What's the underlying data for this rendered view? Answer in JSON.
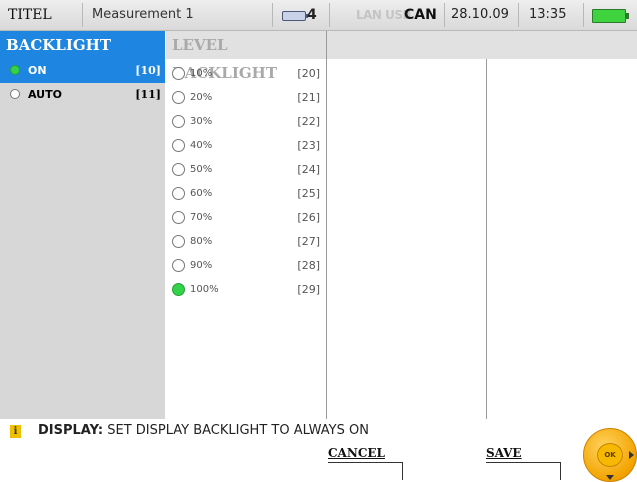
{
  "statusbar": {
    "title": "TITEL",
    "measurement": "Measurement 1",
    "battery_count": "4",
    "can_inactive": "LAN USB",
    "can_label": "CAN",
    "date": "28.10.09",
    "time": "13:35",
    "power_icon": "battery-full-icon",
    "power_color": "#3fd33f"
  },
  "column1": {
    "header": "BACKLIGHT",
    "options": [
      {
        "label": "ON",
        "code": "[10]",
        "selected": true
      },
      {
        "label": "AUTO",
        "code": "[11]",
        "selected": false
      }
    ]
  },
  "column2": {
    "header": "LEVEL BACKLIGHT",
    "levels": [
      {
        "label": "10%",
        "code": "[20]",
        "selected": false
      },
      {
        "label": "20%",
        "code": "[21]",
        "selected": false
      },
      {
        "label": "30%",
        "code": "[22]",
        "selected": false
      },
      {
        "label": "40%",
        "code": "[23]",
        "selected": false
      },
      {
        "label": "50%",
        "code": "[24]",
        "selected": false
      },
      {
        "label": "60%",
        "code": "[25]",
        "selected": false
      },
      {
        "label": "70%",
        "code": "[26]",
        "selected": false
      },
      {
        "label": "80%",
        "code": "[27]",
        "selected": false
      },
      {
        "label": "90%",
        "code": "[28]",
        "selected": false
      },
      {
        "label": "100%",
        "code": "[29]",
        "selected": true
      }
    ]
  },
  "info": {
    "icon": "info-icon",
    "icon_glyph": "i",
    "prefix": "DISPLAY:",
    "text": " SET DISPLAY BACKLIGHT TO ALWAYS ON"
  },
  "softkeys": {
    "cancel": "CANCEL",
    "save": "SAVE"
  },
  "joystick": {
    "label": "OK"
  },
  "colors": {
    "accent": "#1e86e0",
    "selected_radio": "#34d24a",
    "panel_grey": "#d7d7d7"
  }
}
